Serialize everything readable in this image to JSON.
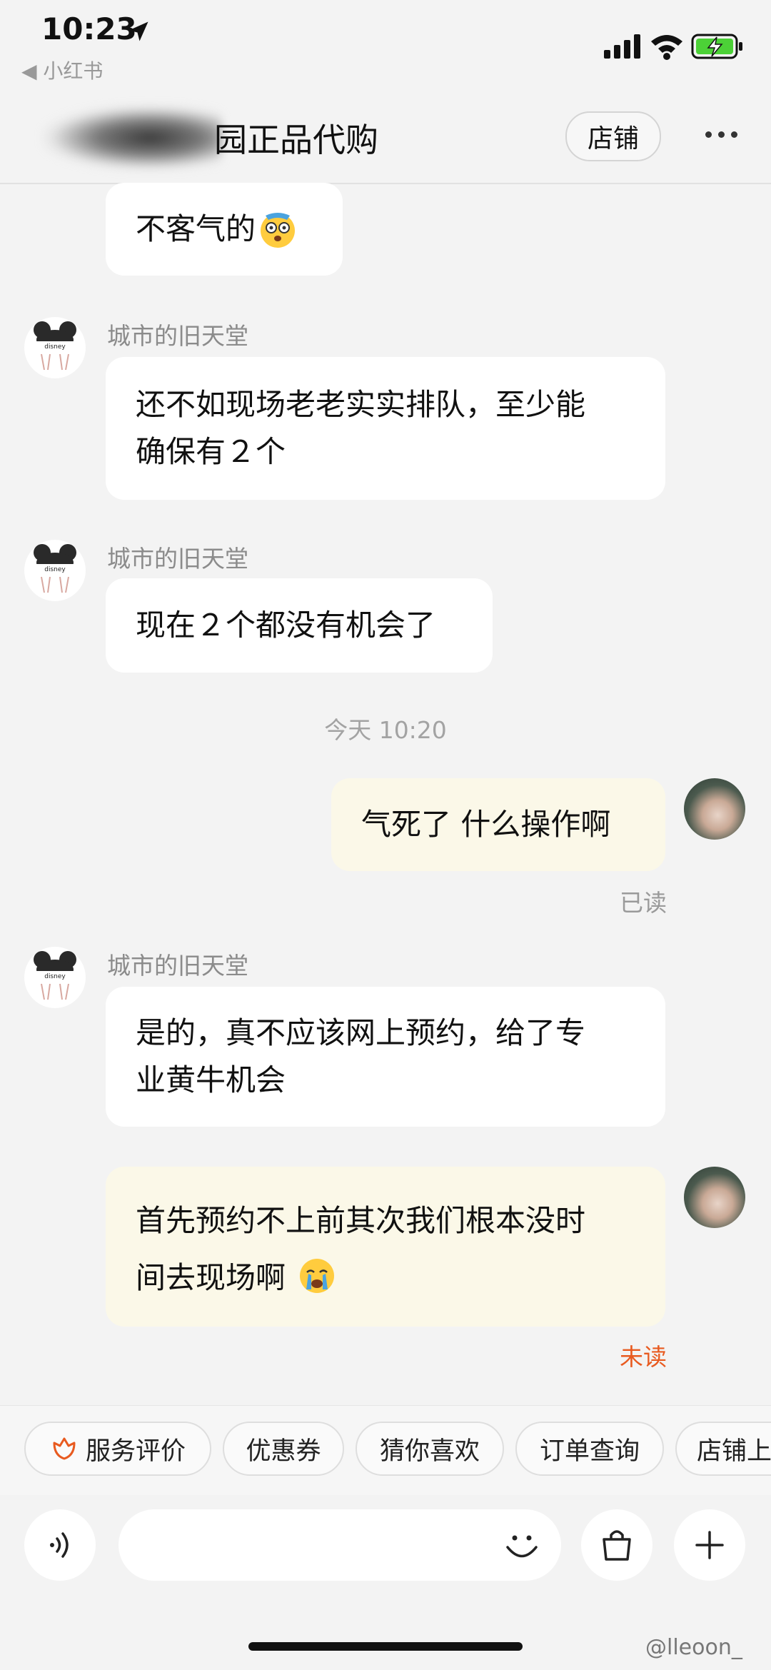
{
  "status_bar": {
    "time": "10:23",
    "back_app": "◀ 小红书"
  },
  "header": {
    "title": "园正品代购",
    "shop_button": "店铺"
  },
  "messages": [
    {
      "text": "不客气的"
    },
    {
      "sender": "城市的旧天堂",
      "text_line1": "还不如现场老老实实排队，至少能",
      "text_line2": "确保有２个"
    },
    {
      "sender": "城市的旧天堂",
      "text": "现在２个都没有机会了"
    },
    {
      "time_divider": "今天 10:20"
    },
    {
      "text": "气死了 什么操作啊",
      "status": "已读"
    },
    {
      "sender": "城市的旧天堂",
      "text_line1": "是的，真不应该网上预约，给了专",
      "text_line2": "业黄牛机会"
    },
    {
      "text_line1": "首先预约不上前其次我们根本没时",
      "text_line2": "间去现场啊",
      "status": "未读"
    }
  ],
  "avatar_label": "disney",
  "quick_actions": [
    "服务评价",
    "优惠券",
    "猜你喜欢",
    "订单查询",
    "店铺上"
  ],
  "watermark": "@lleoon_",
  "colors": {
    "accent": "#e85a1f",
    "bubble_out": "#fbf8e8",
    "bubble_in": "#ffffff",
    "background": "#f3f3f3"
  }
}
